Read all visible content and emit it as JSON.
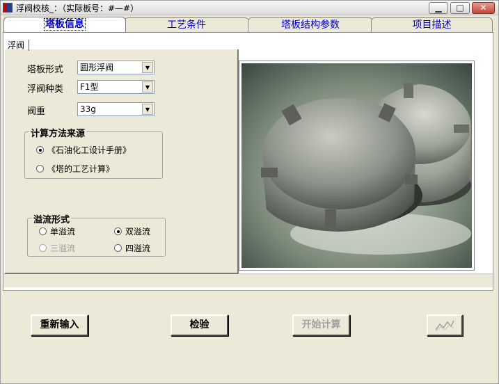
{
  "window": {
    "title": "浮阀校核_：（实际板号：#—#）"
  },
  "tabs": [
    {
      "label": "塔板信息",
      "active": true
    },
    {
      "label": "工艺条件",
      "active": false
    },
    {
      "label": "塔板结构参数",
      "active": false
    },
    {
      "label": "项目描述",
      "active": false
    }
  ],
  "subtab": "浮阀",
  "form": {
    "tray_type": {
      "label": "塔板形式",
      "value": "圆形浮阀"
    },
    "valve_type": {
      "label": "浮阀种类",
      "value": "F1型"
    },
    "valve_weight": {
      "label": "阀重",
      "value": "33g"
    }
  },
  "calc_source": {
    "legend": "计算方法来源",
    "options": [
      {
        "label": "《石油化工设计手册》",
        "selected": true
      },
      {
        "label": "《塔的工艺计算》",
        "selected": false
      }
    ]
  },
  "overflow": {
    "legend": "溢流形式",
    "options": [
      {
        "label": "单溢流",
        "selected": false,
        "enabled": true
      },
      {
        "label": "双溢流",
        "selected": true,
        "enabled": true
      },
      {
        "label": "三溢流",
        "selected": false,
        "enabled": false
      },
      {
        "label": "四溢流",
        "selected": false,
        "enabled": true
      }
    ]
  },
  "buttons": {
    "reset": "重新输入",
    "check": "检验",
    "start": "开始计算",
    "graph_icon": "line-chart-icon"
  },
  "colors": {
    "tab_text": "#0000cc",
    "window_bg": "#ece9d8",
    "close_red": "#c2463a"
  }
}
